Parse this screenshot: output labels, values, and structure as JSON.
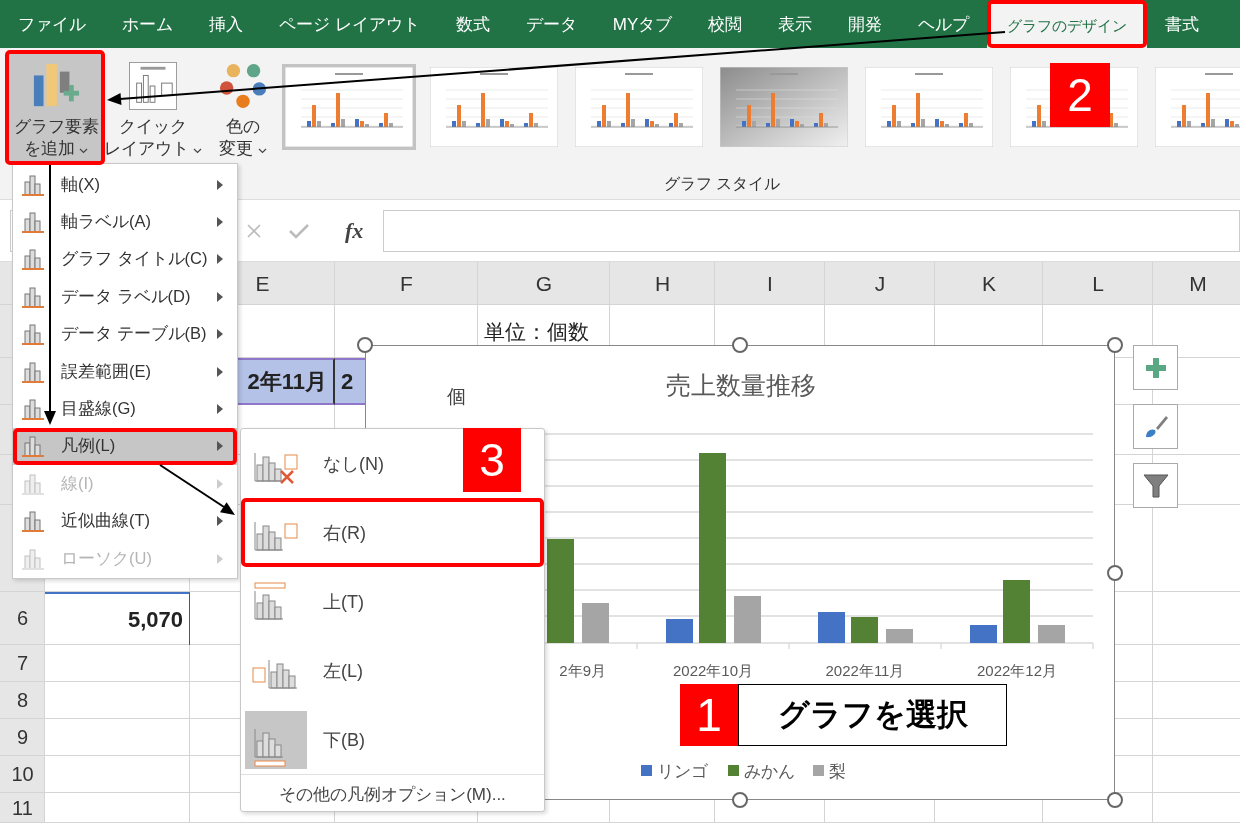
{
  "ribbon_tabs": [
    {
      "label": "ファイル",
      "selected": false
    },
    {
      "label": "ホーム",
      "selected": false
    },
    {
      "label": "挿入",
      "selected": false
    },
    {
      "label": "ページ レイアウト",
      "selected": false
    },
    {
      "label": "数式",
      "selected": false
    },
    {
      "label": "データ",
      "selected": false
    },
    {
      "label": "MYタブ",
      "selected": false
    },
    {
      "label": "校閲",
      "selected": false
    },
    {
      "label": "表示",
      "selected": false
    },
    {
      "label": "開発",
      "selected": false
    },
    {
      "label": "ヘルプ",
      "selected": false
    },
    {
      "label": "グラフのデザイン",
      "selected": true
    },
    {
      "label": "書式",
      "selected": false
    }
  ],
  "ribbon": {
    "add_element": {
      "lines": [
        "グラフ要素",
        "を追加"
      ],
      "pressed": true
    },
    "quick_layout": {
      "lines": [
        "クイック",
        "レイアウト"
      ]
    },
    "change_colors": {
      "lines": [
        "色の",
        "変更"
      ]
    },
    "chart_styles": [
      {
        "selected": true,
        "kind": "plain"
      },
      {
        "selected": false,
        "kind": "plain"
      },
      {
        "selected": false,
        "kind": "plain"
      },
      {
        "selected": false,
        "kind": "shaded"
      },
      {
        "selected": false,
        "kind": "plain"
      },
      {
        "selected": false,
        "kind": "plain"
      },
      {
        "selected": false,
        "kind": "plain"
      }
    ],
    "group_label": "グラフ スタイル"
  },
  "formula_bar": {
    "fx": "fx"
  },
  "sheet": {
    "column_headers": [
      "E",
      "F",
      "G",
      "H",
      "I",
      "J",
      "K",
      "L",
      "M"
    ],
    "unit_label": "単位：個数",
    "header_cells": [
      "2年11月",
      "2"
    ],
    "total": "5,070",
    "row_numbers": [
      "6",
      "7",
      "8",
      "9",
      "10",
      "11"
    ]
  },
  "chart": {
    "title": "売上数量推移",
    "axis_unit": "個",
    "categories": [
      "2年9月",
      "2022年10月",
      "2022年11月",
      "2022年12月"
    ],
    "legend": [
      {
        "label": "リンゴ",
        "color": "#4472c4"
      },
      {
        "label": "みかん",
        "color": "#548235"
      },
      {
        "label": "梨",
        "color": "#a5a5a5"
      }
    ]
  },
  "element_menu": [
    {
      "label": "軸(X)",
      "disabled": false,
      "selected": false
    },
    {
      "label": "軸ラベル(A)",
      "disabled": false,
      "selected": false
    },
    {
      "label": "グラフ タイトル(C)",
      "disabled": false,
      "selected": false
    },
    {
      "label": "データ ラベル(D)",
      "disabled": false,
      "selected": false
    },
    {
      "label": "データ テーブル(B)",
      "disabled": false,
      "selected": false
    },
    {
      "label": "誤差範囲(E)",
      "disabled": false,
      "selected": false
    },
    {
      "label": "目盛線(G)",
      "disabled": false,
      "selected": false
    },
    {
      "label": "凡例(L)",
      "disabled": false,
      "selected": true
    },
    {
      "label": "線(I)",
      "disabled": true,
      "selected": false
    },
    {
      "label": "近似曲線(T)",
      "disabled": false,
      "selected": false
    },
    {
      "label": "ローソク(U)",
      "disabled": true,
      "selected": false
    }
  ],
  "legend_menu": {
    "items": [
      {
        "label": "なし(N)",
        "kind": "none",
        "selected": false,
        "highlighted": false
      },
      {
        "label": "右(R)",
        "kind": "right",
        "selected": false,
        "highlighted": true
      },
      {
        "label": "上(T)",
        "kind": "top",
        "selected": false,
        "highlighted": false
      },
      {
        "label": "左(L)",
        "kind": "left",
        "selected": false,
        "highlighted": false
      },
      {
        "label": "下(B)",
        "kind": "bottom",
        "selected": true,
        "highlighted": false
      }
    ],
    "more": "その他の凡例オプション(M)..."
  },
  "annotations": {
    "step_1": {
      "number": "1",
      "text": "グラフを選択"
    },
    "step_2": {
      "number": "2"
    },
    "step_3": {
      "number": "3"
    }
  }
}
